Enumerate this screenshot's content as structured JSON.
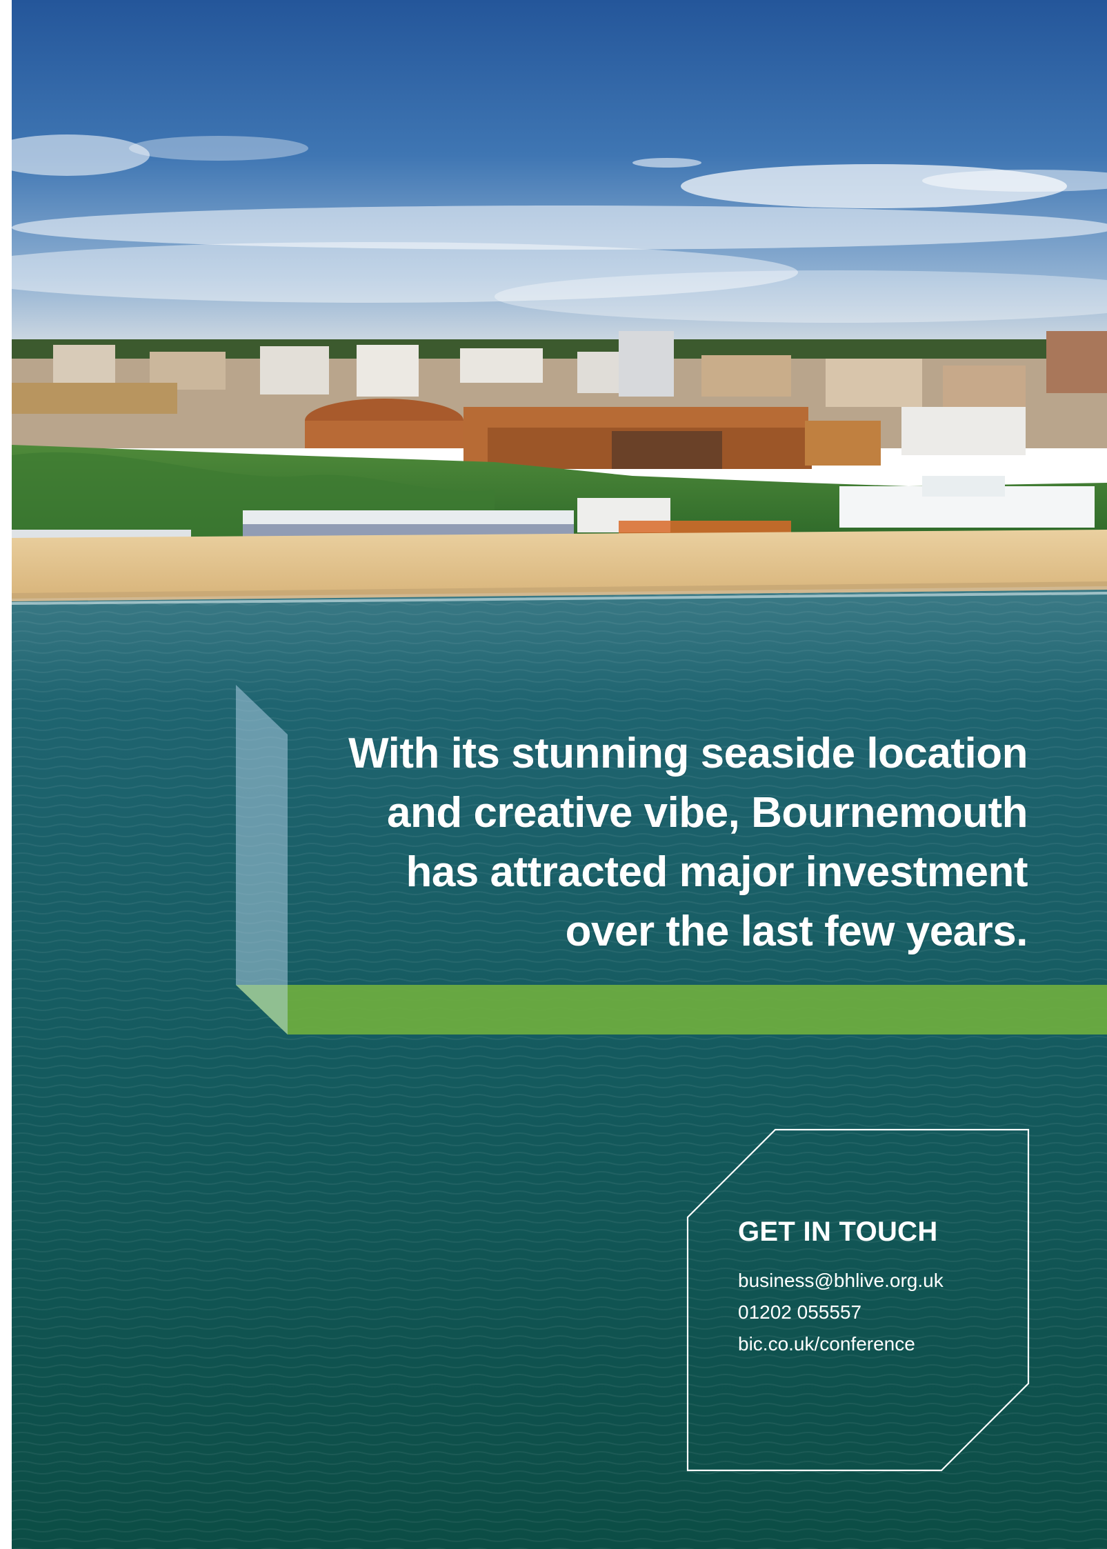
{
  "headline": {
    "lines": [
      "With its stunning seaside location",
      "and creative vibe, Bournemouth",
      "has attracted major investment",
      "over the last few years."
    ]
  },
  "contact": {
    "heading": "GET IN TOUCH",
    "email": "business@bhlive.org.uk",
    "phone": "01202 055557",
    "website": "bic.co.uk/conference"
  },
  "colors": {
    "accent_green": "#6fae3f",
    "accent_blue": "#a9cbe0",
    "sea": "#0f5a55",
    "sky": "#2f65a6",
    "sand": "#e6c890"
  },
  "image": {
    "subject": "aerial seafront photo: town, cliffs, sandy beach and sea"
  }
}
